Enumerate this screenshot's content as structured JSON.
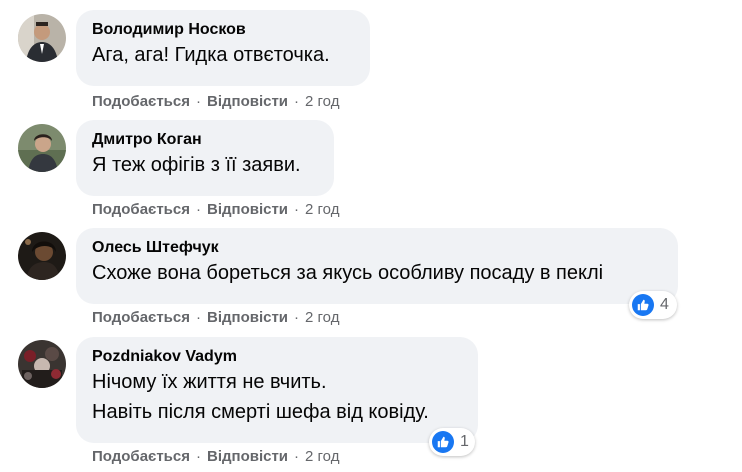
{
  "actions": {
    "like_label": "Подобається",
    "reply_label": "Відповісти",
    "separator": "·"
  },
  "comments": [
    {
      "author": "Володимир Носков",
      "lines": [
        "Ага, ага! Гидка отвєточка."
      ],
      "time": "2 год"
    },
    {
      "author": "Дмитро Коган",
      "lines": [
        "Я теж офігів з її заяви."
      ],
      "time": "2 год"
    },
    {
      "author": "Олесь Штефчук",
      "lines": [
        "Схоже вона бореться за якусь особливу посаду в пеклі"
      ],
      "time": "2 год",
      "reaction": {
        "icon": "like-icon",
        "count": "4"
      }
    },
    {
      "author": "Pozdniakov Vadym",
      "lines": [
        "Нічому їх життя не вчить.",
        "Навіть після смерті шефа від ковіду."
      ],
      "time": "2 год",
      "reaction": {
        "icon": "like-icon",
        "count": "1"
      }
    }
  ],
  "colors": {
    "bubble_bg": "#f0f2f5",
    "meta_text": "#65676b",
    "like_blue": "#1877f2"
  }
}
